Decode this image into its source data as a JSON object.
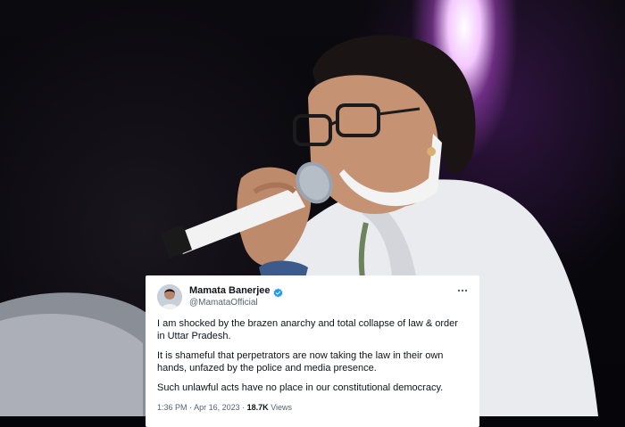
{
  "tweet": {
    "author_name": "Mamata Banerjee",
    "author_handle": "@MamataOfficial",
    "menu_icon": "more-horizontal-icon",
    "verified_icon": "verified-badge-icon",
    "paragraphs": [
      "I am shocked by the brazen anarchy and total collapse of law & order in Uttar Pradesh.",
      "It is shameful that perpetrators are now taking the law in their own hands, unfazed by the police and media presence.",
      "Such unlawful acts have no place in our constitutional democracy."
    ],
    "time": "1:36 PM",
    "separator": "·",
    "date": "Apr 16, 2023",
    "views_count": "18.7K",
    "views_label": "Views",
    "verified_color": "#1d9bf0"
  }
}
